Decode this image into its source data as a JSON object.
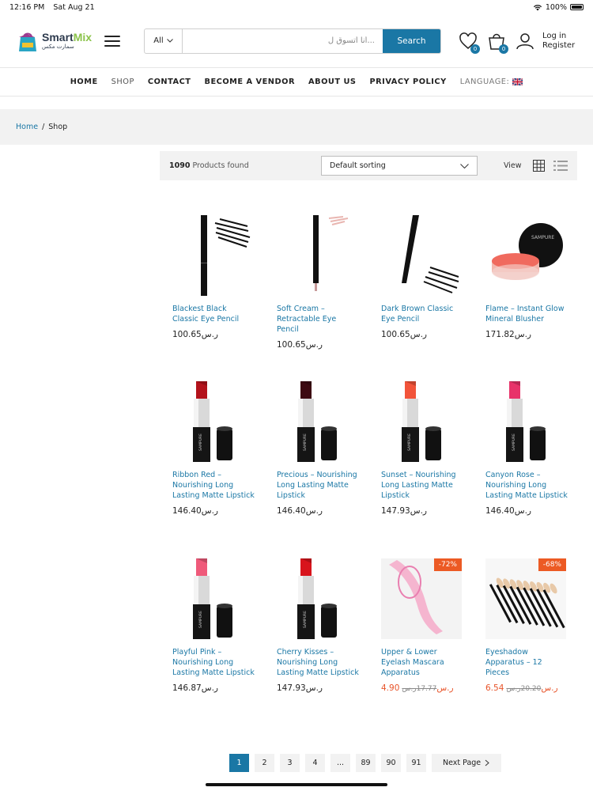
{
  "status": {
    "time": "12:16 PM",
    "date": "Sat Aug 21",
    "battery": "100%"
  },
  "header": {
    "logo_en": "Smart",
    "logo_en_accent": "Mix",
    "logo_ar": "سمارت مكس",
    "search_category": "All",
    "search_placeholder": "...أنا أتسوق ل",
    "search_button": "Search",
    "wishlist_count": "0",
    "cart_count": "0",
    "login": "Log in",
    "register": "Register"
  },
  "nav": {
    "home": "HOME",
    "shop": "SHOP",
    "contact": "CONTACT",
    "vendor": "BECOME A VENDOR",
    "about": "ABOUT US",
    "privacy": "PRIVACY POLICY",
    "language": "LANGUAGE:"
  },
  "breadcrumb": {
    "home": "Home",
    "current": "Shop"
  },
  "toolbar": {
    "count": "1090",
    "found": "Products found",
    "sorting": "Default sorting",
    "view": "View"
  },
  "products": [
    {
      "title": "Blackest Black Classic Eye Pencil",
      "price": "100.65ر.س"
    },
    {
      "title": "Soft Cream – Retractable Eye Pencil",
      "price": "100.65ر.س"
    },
    {
      "title": "Dark Brown Classic Eye Pencil",
      "price": "100.65ر.س"
    },
    {
      "title": "Flame – Instant Glow Mineral Blusher",
      "price": "171.82ر.س"
    },
    {
      "title": "Ribbon Red – Nourishing Long Lasting Matte Lipstick",
      "price": "146.40ر.س",
      "color": "#b3121b"
    },
    {
      "title": "Precious – Nourishing Long Lasting Matte Lipstick",
      "price": "146.40ر.س",
      "color": "#3d0a12"
    },
    {
      "title": "Sunset – Nourishing Long Lasting Matte Lipstick",
      "price": "147.93ر.س",
      "color": "#f2543a"
    },
    {
      "title": "Canyon Rose – Nourishing Long Lasting Matte Lipstick",
      "price": "146.40ر.س",
      "color": "#e8336a"
    },
    {
      "title": "Playful Pink – Nourishing Long Lasting Matte Lipstick",
      "price": "146.87ر.س",
      "color": "#ef5a7a"
    },
    {
      "title": "Cherry Kisses – Nourishing Long Lasting Matte Lipstick",
      "price": "147.93ر.س",
      "color": "#d8141c"
    },
    {
      "title": "Upper & Lower Eyelash Mascara Apparatus",
      "sale_price": "4.90ر.س",
      "old_price": "17.77ر.س",
      "badge": "-72%"
    },
    {
      "title": "Eyeshadow Apparatus – 12 Pieces",
      "sale_price": "6.54ر.س",
      "old_price": "20.20ر.س",
      "badge": "-68%"
    }
  ],
  "pagination": {
    "pages": [
      "1",
      "2",
      "3",
      "4",
      "...",
      "89",
      "90",
      "91"
    ],
    "next": "Next Page"
  },
  "colors": {
    "accent": "#1a77a5",
    "sale": "#e8542a"
  }
}
